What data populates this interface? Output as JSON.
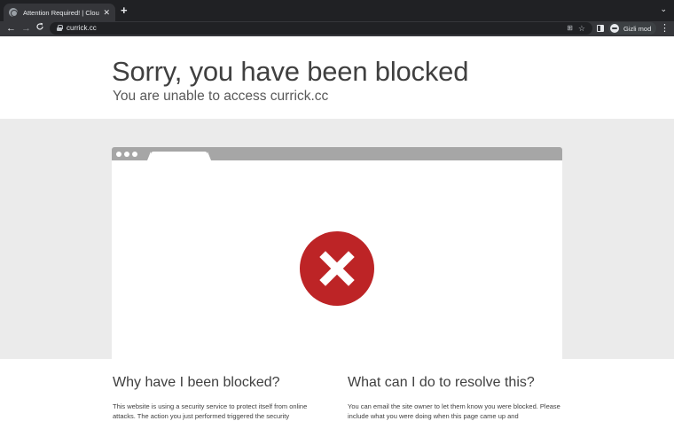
{
  "browser": {
    "tab_title": "Attention Required! | Cloudflare",
    "tab_close": "✕",
    "new_tab": "+",
    "tab_menu": "⌄",
    "nav_back": "←",
    "nav_forward": "→",
    "nav_reload": "C",
    "url": "currick.cc",
    "translate_icon": "⊞",
    "star_icon": "☆",
    "profile_label": "Gizli mod",
    "menu_icon": "⋮"
  },
  "page": {
    "heading": "Sorry, you have been blocked",
    "subheading": "You are unable to access currick.cc",
    "why_heading": "Why have I been blocked?",
    "why_text": "This website is using a security service to protect itself from online attacks. The action you just performed triggered the security",
    "resolve_heading": "What can I do to resolve this?",
    "resolve_text": "You can email the site owner to let them know you were blocked. Please include what you were doing when this page came up and"
  },
  "colors": {
    "block_icon_red": "#bd2426",
    "band_gray": "#ebebeb",
    "chrome_dark": "#202124"
  },
  "icons": {
    "block": "x-circle-icon"
  }
}
